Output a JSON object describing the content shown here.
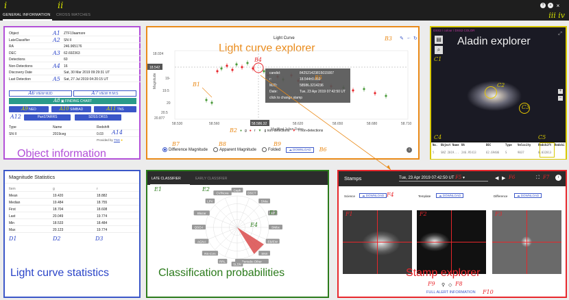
{
  "tabs": [
    {
      "label": "GENERAL INFORMATION",
      "ann": "i"
    },
    {
      "label": "CROSS MATCHES",
      "ann": "ii"
    }
  ],
  "top_ann": "iii iv",
  "top_icons": [
    "?",
    "+",
    "×"
  ],
  "object": {
    "rows": [
      {
        "k": "Object",
        "ann": "A1",
        "v": "ZTF19aamsre"
      },
      {
        "k": "LateClassifier",
        "ann": "A2",
        "v": "SN II"
      },
      {
        "k": "RA",
        "ann": "",
        "v": "246.965176"
      },
      {
        "k": "DEC",
        "ann": "A3",
        "v": "62.692363"
      },
      {
        "k": "Detections",
        "ann": "",
        "v": "60"
      },
      {
        "k": "Non-Detections",
        "ann": "A4",
        "v": "16"
      },
      {
        "k": "Discovery Date",
        "ann": "",
        "v": "Sat, 30 Mar 2019 09:29:31 UT"
      },
      {
        "k": "Last Detection",
        "ann": "A5",
        "v": "Sat, 27 Jul 2019 04:20:15 UT"
      }
    ],
    "view_mjd": "VIEW MJD",
    "view_hms": "VIEW H:M:S",
    "ann_a6": "A6",
    "ann_a7": "A7",
    "finding_chart": "FINDING CHART",
    "ann_a8": "A8",
    "ned": "NED",
    "simbad": "SIMBAD",
    "tns": "TNS",
    "ann_a9": "A9",
    "ann_a10": "A10",
    "ann_a11": "A11",
    "panstarrs": "PanSTARRS",
    "sdss": "SDSS DR15",
    "ann_a12": "A12",
    "t_type": "Type",
    "t_name": "Name",
    "t_redshift": "Redshift",
    "t_v_type": "SN II",
    "t_v_name": "2019ceg",
    "t_v_redshift": "0.03",
    "ann_a13": "A13",
    "ann_a14": "A14",
    "provided": "Provided by",
    "provided_link": "TNS",
    "big": "Object information"
  },
  "lightcurve": {
    "title": "Light Curve",
    "big": "Light curve explorer",
    "ann_b1": "B1",
    "ann_b2": "B2",
    "ann_b3": "B3",
    "ann_b4": "B4",
    "ann_b5": "B5",
    "ann_b6": "B6",
    "ann_b7": "B7",
    "ann_b8": "B8",
    "ann_b9": "B9",
    "ylabel": "Magnitude",
    "xlabel": "Modified Julian Dates",
    "y_ticks": [
      "18.024",
      "18.542",
      "19-",
      "19.5",
      "20",
      "20.5",
      "20.877"
    ],
    "x_ticks": [
      "58.530",
      "58.560",
      "58.590",
      "58.620",
      "58.650",
      "58.680",
      "58.710"
    ],
    "x_highlight": "58.586.32",
    "legend": [
      "g",
      "r",
      "g non-detections",
      "r non-detections"
    ],
    "tooltip": {
      "candid": "842521423815015007",
      "mag": "18.544±0.059",
      "mjd": "58586.3214236",
      "date": "Tue, 23 Apr 2019 07:42:50 UT",
      "hint": "click to change stamp",
      "k_candid": "candid:",
      "k_mag": "r:",
      "k_mjd": "MJD:",
      "k_date": "Date:"
    },
    "opt_diff": "Difference Magnitude",
    "opt_app": "Apparent Magnitude",
    "opt_fold": "Folded",
    "download": "DOWNLOAD"
  },
  "aladin": {
    "big": "Aladin explorer",
    "survey": "DSS2 / colour / DSS2 COLOR",
    "ann_c1": "C1",
    "ann_c2": "C2",
    "ann_c3": "C3",
    "ann_c4": "C4",
    "ann_c5": "C5",
    "cols": [
      "No.",
      "Object Name",
      "RA",
      "DEC",
      "Type",
      "Velocity",
      "Redshift",
      "Redshi"
    ],
    "row": [
      "5",
      "SNZ 2019...",
      "246.95413",
      "62.69406",
      "S",
      "9037",
      "0.032813",
      ""
    ]
  },
  "magstats": {
    "title": "Magnitude Statistics",
    "cols": [
      "Item",
      "g",
      "r"
    ],
    "rows": [
      [
        "Mean",
        "19.420",
        "18.882"
      ],
      [
        "Median",
        "19.484",
        "18.755"
      ],
      [
        "First",
        "18.704",
        "18.608"
      ],
      [
        "Last",
        "20.049",
        "19.774"
      ],
      [
        "Min",
        "18.533",
        "18.484"
      ],
      [
        "Max",
        "20.123",
        "19.774"
      ]
    ],
    "ann_d1": "D1",
    "ann_d2": "D2",
    "ann_d3": "D3",
    "big": "Light curve statistics"
  },
  "classify": {
    "tab1": "LATE CLASSIFIER",
    "tab2": "EARLY CLASSIFIER",
    "ann_e1": "E1",
    "ann_e2": "E2",
    "ann_e3": "E3",
    "ann_e4": "E4",
    "labels": [
      "Ceph",
      "DSCT",
      "SNIa",
      "EBC",
      "SNibc",
      "EB/EW",
      "SNII",
      "Periodic-Other",
      "SLSN",
      "RRL",
      "RS-CVn",
      "AGN-I",
      "QSO-I",
      "Blazar",
      "LPV",
      "CV/Nova"
    ],
    "big": "Classification probabilities"
  },
  "stamps": {
    "title": "Stamps",
    "date": "Tue, 23 Apr 2019 07:42:50 UT",
    "ann_f1": "F1",
    "ann_f2": "F2",
    "ann_f3": "F3",
    "ann_f4": "F4",
    "ann_f5": "F5",
    "ann_f6": "F6",
    "ann_f7": "F7",
    "ann_f8": "F8",
    "ann_f9": "F9",
    "ann_f10": "F10",
    "science": "Science",
    "template": "Template",
    "difference": "Difference",
    "download": "DOWNLOAD",
    "full": "FULL ALERT INFORMATION",
    "big": "Stamp explorer"
  }
}
